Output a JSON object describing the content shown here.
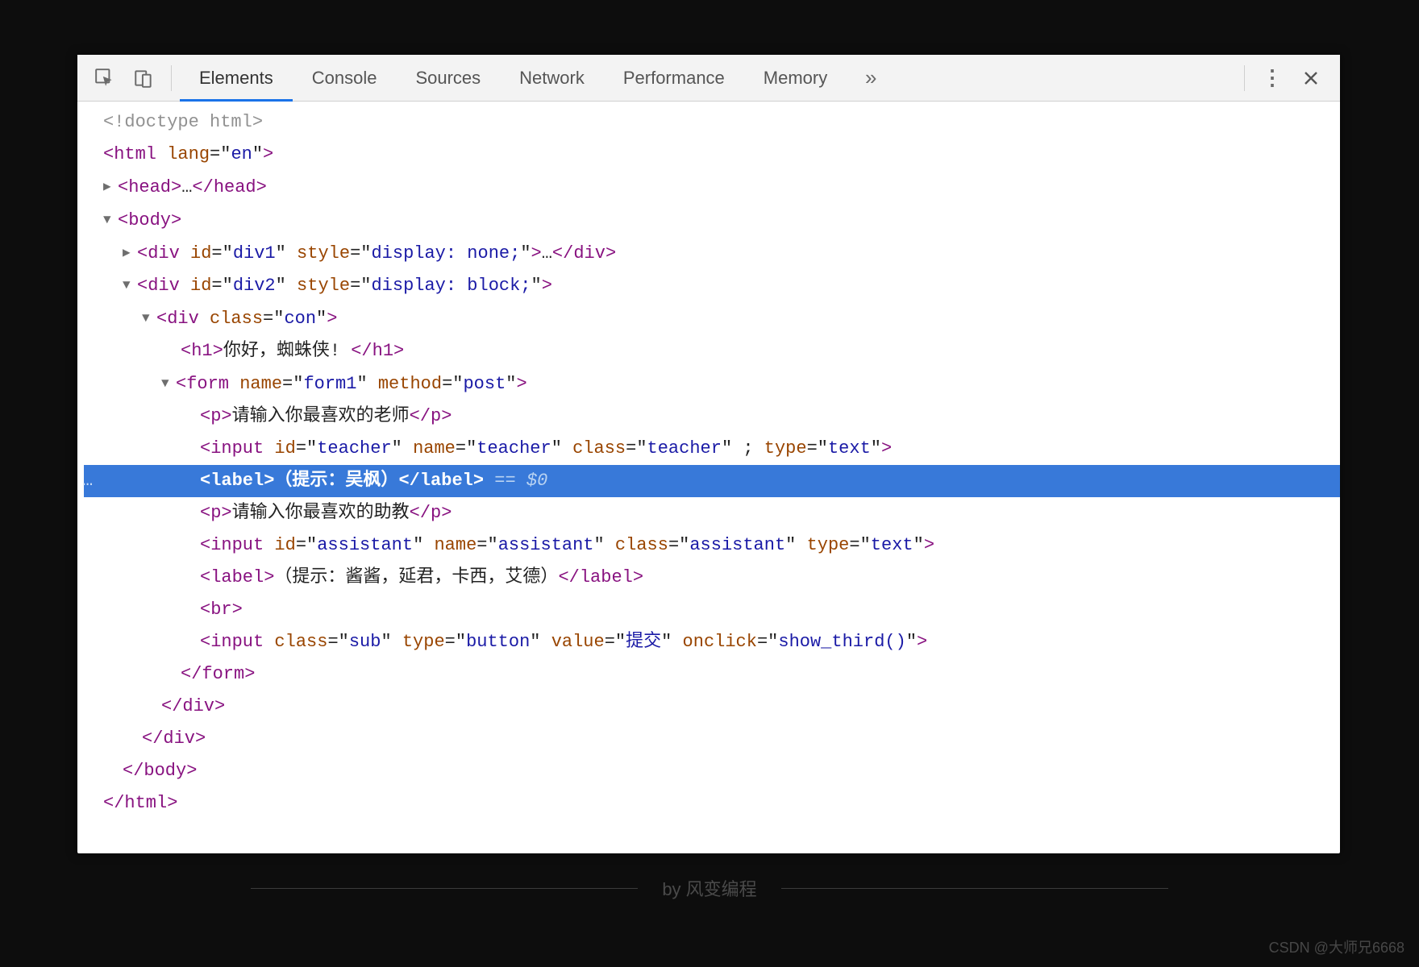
{
  "tabs": {
    "elements": "Elements",
    "console": "Console",
    "sources": "Sources",
    "network": "Network",
    "performance": "Performance",
    "memory": "Memory"
  },
  "dom": {
    "doctype": "<!doctype html>",
    "html_open": {
      "tag": "html",
      "attr_lang": "lang",
      "val_lang": "en"
    },
    "head": {
      "open": "head",
      "ellipsis": "…",
      "close": "head"
    },
    "body_open": "body",
    "div1": {
      "tag": "div",
      "attr_id": "id",
      "val_id": "div1",
      "attr_style": "style",
      "val_style": "display: none;",
      "ellipsis": "…"
    },
    "div2": {
      "tag": "div",
      "attr_id": "id",
      "val_id": "div2",
      "attr_style": "style",
      "val_style": "display: block;"
    },
    "con": {
      "tag": "div",
      "attr_class": "class",
      "val_class": "con"
    },
    "h1": {
      "tag": "h1",
      "text": "你好，蜘蛛侠! "
    },
    "form": {
      "tag": "form",
      "attr_name": "name",
      "val_name": "form1",
      "attr_method": "method",
      "val_method": "post"
    },
    "p1": {
      "tag": "p",
      "text": "请输入你最喜欢的老师"
    },
    "input1": {
      "tag": "input",
      "attr_id": "id",
      "val_id": "teacher",
      "attr_name": "name",
      "val_name": "teacher",
      "attr_class": "class",
      "val_class": "teacher",
      "semi": " ;",
      "attr_type": "type",
      "val_type": "text"
    },
    "label1": {
      "tag": "label",
      "text": "（提示：吴枫）",
      "ref": "== $0"
    },
    "p2": {
      "tag": "p",
      "text": "请输入你最喜欢的助教"
    },
    "input2": {
      "tag": "input",
      "attr_id": "id",
      "val_id": "assistant",
      "attr_name": "name",
      "val_name": "assistant",
      "attr_class": "class",
      "val_class": "assistant",
      "attr_type": "type",
      "val_type": "text"
    },
    "label2": {
      "tag": "label",
      "text": "（提示：酱酱，延君，卡西，艾德）"
    },
    "br": "br",
    "input3": {
      "tag": "input",
      "attr_class": "class",
      "val_class": "sub",
      "attr_type": "type",
      "val_type": "button",
      "attr_value": "value",
      "val_value": "提交",
      "attr_onclick": "onclick",
      "val_onclick": "show_third()"
    },
    "form_close": "form",
    "con_close": "div",
    "div2_close": "div",
    "body_close": "body",
    "html_close": "html"
  },
  "footer": "by 风变编程",
  "watermark": "CSDN @大师兄6668"
}
